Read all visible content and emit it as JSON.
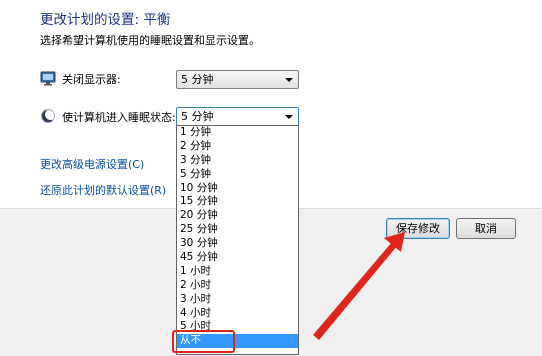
{
  "header": {
    "title": "更改计划的设置: 平衡",
    "subtitle": "选择希望计算机使用的睡眠设置和显示设置。"
  },
  "settings": {
    "display_off": {
      "label": "关闭显示器:",
      "value": "5 分钟",
      "icon": "monitor-icon"
    },
    "sleep": {
      "label": "使计算机进入睡眠状态:",
      "value": "5 分钟",
      "icon": "moon-icon"
    }
  },
  "links": {
    "advanced": "更改高级电源设置(C)",
    "restore": "还原此计划的默认设置(R)"
  },
  "buttons": {
    "save": "保存修改",
    "cancel": "取消"
  },
  "dropdown": {
    "options": [
      "1 分钟",
      "2 分钟",
      "3 分钟",
      "5 分钟",
      "10 分钟",
      "15 分钟",
      "20 分钟",
      "25 分钟",
      "30 分钟",
      "45 分钟",
      "1 小时",
      "2 小时",
      "3 小时",
      "4 小时",
      "5 小时",
      "从不"
    ],
    "selected": "从不"
  },
  "colors": {
    "title": "#1e3287",
    "link": "#0b4fa8",
    "selection": "#3399ff",
    "annotation": "#e0261b"
  }
}
